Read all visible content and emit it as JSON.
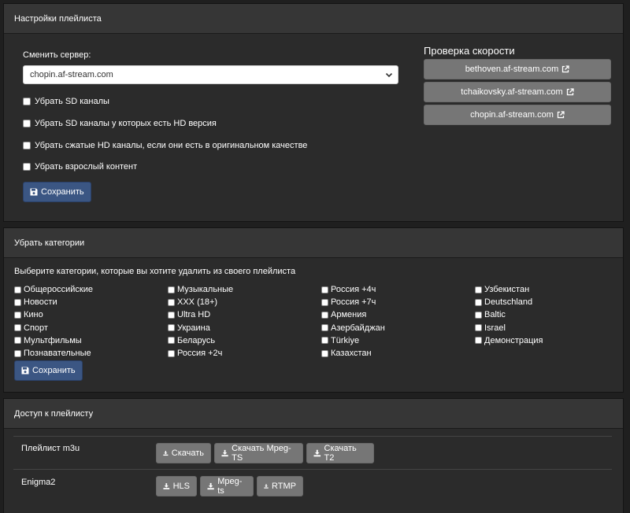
{
  "playlist_settings": {
    "title": "Настройки плейлиста",
    "server_label": "Сменить сервер:",
    "server_selected": "chopin.af-stream.com",
    "options": [
      "Убрать SD каналы",
      "Убрать SD каналы у которых есть HD версия",
      "Убрать сжатые HD каналы, если они есть в оригинальном качестве",
      "Убрать взрослый контент"
    ],
    "save_label": "Сохранить",
    "speed_title": "Проверка скорости",
    "speed_servers": [
      "bethoven.af-stream.com",
      "tchaikovsky.af-stream.com",
      "chopin.af-stream.com"
    ]
  },
  "remove_categories": {
    "title": "Убрать категории",
    "instruction": "Выберите категории, которые вы хотите удалить из своего плейлиста",
    "columns": [
      [
        "Общероссийские",
        "Новости",
        "Кино",
        "Спорт",
        "Мультфильмы",
        "Познавательные"
      ],
      [
        "Музыкальные",
        "XXX (18+)",
        "Ultra HD",
        "Украина",
        "Беларусь",
        "Россия +2ч"
      ],
      [
        "Россия +4ч",
        "Россия +7ч",
        "Армения",
        "Азербайджан",
        "Türkiye",
        "Казахстан"
      ],
      [
        "Узбекистан",
        "Deutschland",
        "Baltic",
        "Israel",
        "Демонстрация"
      ]
    ],
    "save_label": "Сохранить"
  },
  "playlist_access": {
    "title": "Доступ к плейлисту",
    "m3u_label": "Плейлист m3u",
    "m3u_buttons": [
      "Скачать",
      "Скачать Mpeg-TS",
      "Скачать T2"
    ],
    "enigma_label": "Enigma2",
    "enigma_buttons": [
      "HLS",
      "Mpeg-ts",
      "RTMP"
    ]
  },
  "colors": {
    "background": "#1f1f1f",
    "panel": "#2b2b2b",
    "panel_header": "#363636",
    "primary_button": "#3b5683",
    "secondary_button": "#767676"
  }
}
